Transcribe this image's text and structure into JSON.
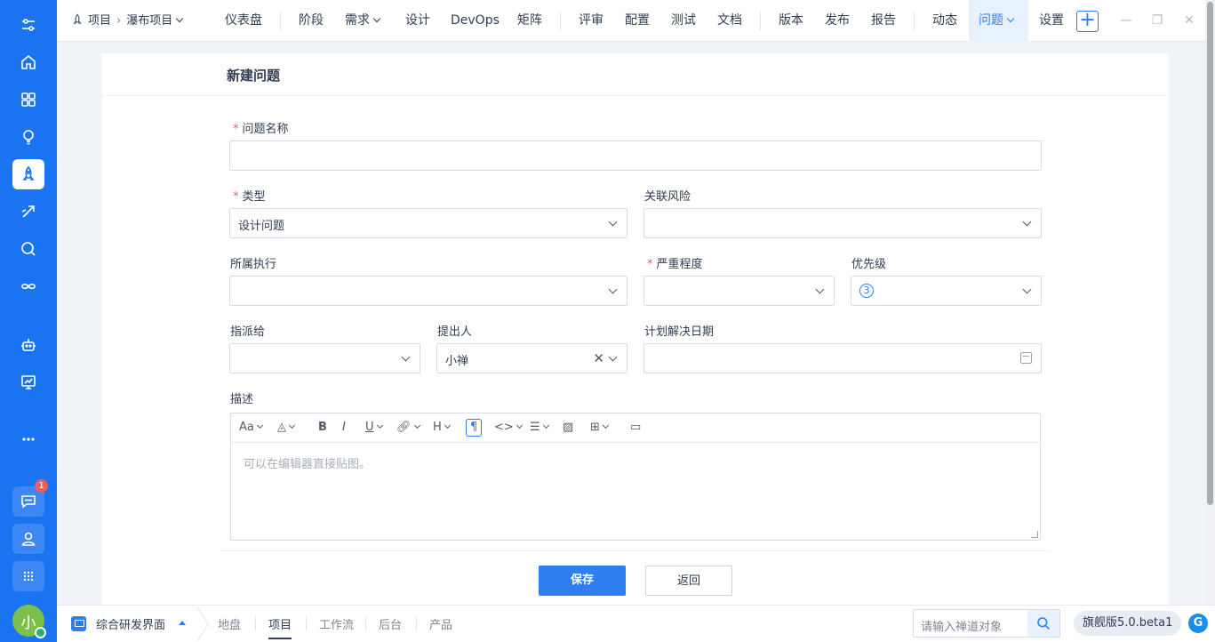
{
  "colors": {
    "rail": "#1a73f1",
    "accent": "#2e7ef0",
    "required": "#f15b5b",
    "badge": "#f15b5b",
    "avatar": "#7cc04b"
  },
  "rail": {
    "items": [
      "settings-sliders-icon",
      "home-icon",
      "apps-grid-icon",
      "lightbulb-icon",
      "rocket-icon",
      "sprint-icon",
      "search-circle-icon",
      "infinity-icon",
      "robot-icon",
      "board-icon",
      "more-icon",
      "chat-icon",
      "user-icon",
      "grid-menu-icon"
    ],
    "active": "rocket-icon",
    "chat_badge": "1",
    "avatar_text": "小"
  },
  "topnav": {
    "project_icon": "rocket-icon",
    "project_label": "项目",
    "project_sub": "瀑布项目",
    "items": [
      "仪表盘",
      "阶段",
      "需求",
      "设计",
      "DevOps",
      "矩阵",
      "评审",
      "配置",
      "测试",
      "文档",
      "版本",
      "发布",
      "报告",
      "动态",
      "问题",
      "设置"
    ],
    "active": "问题",
    "plus": "+"
  },
  "form": {
    "title": "新建问题",
    "required_mark": "*",
    "name_label": "问题名称",
    "name_value": "",
    "type_label": "类型",
    "type_value": "设计问题",
    "risk_label": "关联风险",
    "risk_value": "",
    "execution_label": "所属执行",
    "execution_value": "",
    "severity_label": "严重程度",
    "severity_value": "",
    "priority_label": "优先级",
    "priority_value": "3",
    "assignee_label": "指派给",
    "assignee_value": "",
    "reporter_label": "提出人",
    "reporter_value": "小禅",
    "due_label": "计划解决日期",
    "due_value": "",
    "desc_label": "描述",
    "desc_placeholder": "可以在编辑器直接贴图。",
    "toolbar": [
      "font-size-icon",
      "text-color-icon",
      "bold-icon",
      "italic-icon",
      "underline-icon",
      "link-icon",
      "heading-icon",
      "paragraph-icon",
      "code-icon",
      "list-icon",
      "image-icon",
      "table-icon",
      "template-icon"
    ],
    "save_label": "保存",
    "back_label": "返回"
  },
  "bottombar": {
    "workspace": "综合研发界面",
    "tabs": [
      "地盘",
      "项目",
      "工作流",
      "后台",
      "产品"
    ],
    "active": "项目",
    "search_placeholder": "请输入禅道对象",
    "version": "旗舰版5.0.beta1"
  }
}
